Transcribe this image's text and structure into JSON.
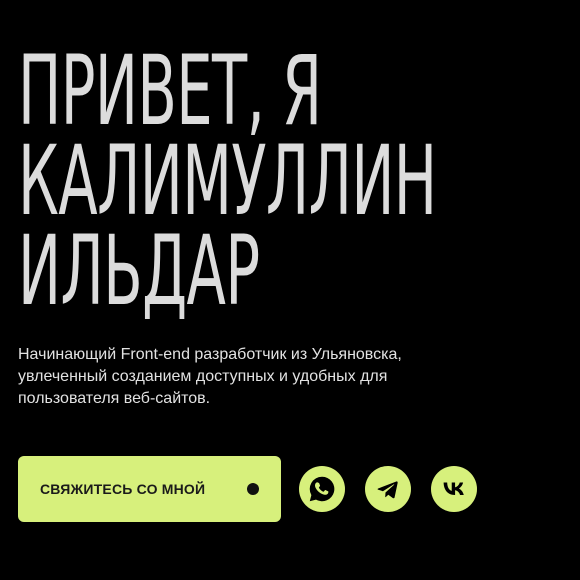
{
  "hero": {
    "title_lines": [
      "ПРИВЕТ, Я",
      "КАЛИМУЛЛИН",
      "ИЛЬДАР"
    ],
    "description": "Начинающий Front-end разработчик из Ульяновска, увлеченный созданием доступных и удобных для пользователя веб-сайтов."
  },
  "actions": {
    "contact_label": "СВЯЖИТЕСЬ СО МНОЙ"
  },
  "social": [
    {
      "icon": "whatsapp-icon"
    },
    {
      "icon": "telegram-icon"
    },
    {
      "icon": "vk-icon"
    }
  ],
  "colors": {
    "background": "#000000",
    "accent": "#d7f07c",
    "title": "#dcdcdc",
    "text": "#e2e2e2"
  }
}
